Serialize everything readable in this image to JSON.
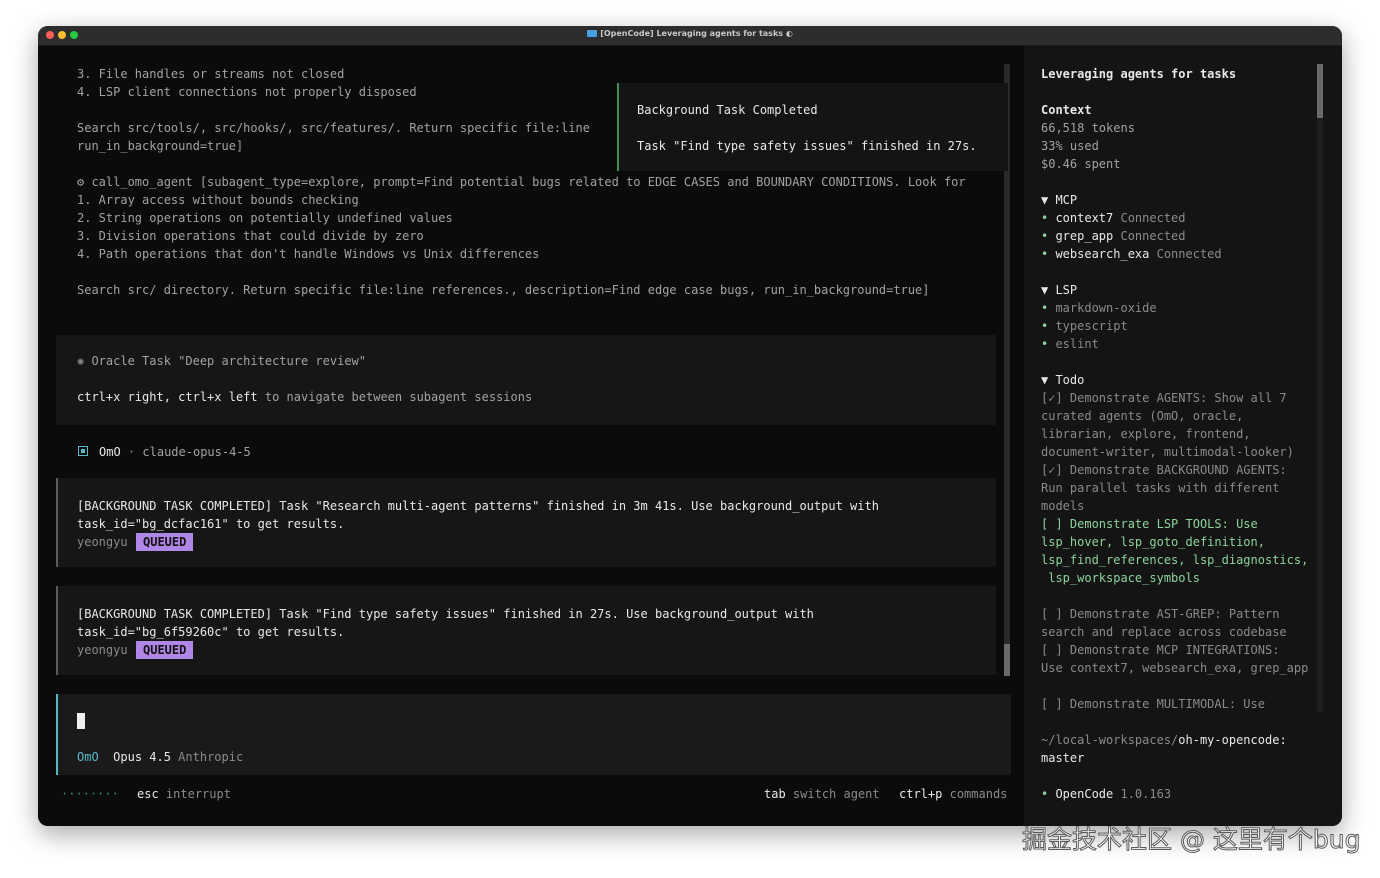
{
  "window": {
    "title": "[OpenCode] Leveraging agents for tasks ◐"
  },
  "main": {
    "top_lines": [
      "3. File handles or streams not closed",
      "4. LSP client connections not properly disposed"
    ],
    "search_lines": [
      "Search src/tools/, src/hooks/, src/features/. Return specific file:line",
      "run_in_background=true]"
    ],
    "call_line": "call_omo_agent [subagent_type=explore, prompt=Find potential bugs related to EDGE CASES and BOUNDARY CONDITIONS. Look for",
    "call_items": [
      "1. Array access without bounds checking",
      "2. String operations on potentially undefined values",
      "3. Division operations that could divide by zero",
      "4. Path operations that don't handle Windows vs Unix differences"
    ],
    "call_tail": "Search src/ directory. Return specific file:line references., description=Find edge case bugs, run_in_background=true]",
    "oracle": {
      "line": "Oracle Task \"Deep architecture review\"",
      "nav_keys1": "ctrl+x right",
      "nav_sep": ", ",
      "nav_keys2": "ctrl+x left",
      "nav_text": " to navigate between subagent sessions"
    },
    "agent": {
      "name": "OmO",
      "sep": "·",
      "model": "claude-opus-4-5"
    },
    "messages": [
      {
        "line1": "[BACKGROUND TASK COMPLETED] Task \"Research multi-agent patterns\" finished in 3m 41s. Use background_output with",
        "line2": "task_id=\"bg_dcfac161\" to get results.",
        "user": "yeongyu",
        "badge": "QUEUED"
      },
      {
        "line1": "[BACKGROUND TASK COMPLETED] Task \"Find type safety issues\" finished in 27s. Use background_output with",
        "line2": "task_id=\"bg_6f59260c\" to get results.",
        "user": "yeongyu",
        "badge": "QUEUED"
      }
    ],
    "input": {
      "agent": "OmO",
      "model": "Opus 4.5",
      "provider": "Anthropic"
    },
    "footer": {
      "dots": "········",
      "esc_key": "esc",
      "esc_label": "interrupt",
      "tab_key": "tab",
      "tab_label": "switch agent",
      "cmd_key": "ctrl+p",
      "cmd_label": "commands"
    }
  },
  "toast": {
    "title": "Background Task Completed",
    "body": "Task \"Find type safety issues\" finished in 27s."
  },
  "sidebar": {
    "title": "Leveraging agents for tasks",
    "context": {
      "heading": "Context",
      "tokens": "66,518 tokens",
      "used": "33% used",
      "spent": "$0.46 spent"
    },
    "mcp": {
      "heading": "MCP",
      "items": [
        {
          "name": "context7",
          "status": "Connected"
        },
        {
          "name": "grep_app",
          "status": "Connected"
        },
        {
          "name": "websearch_exa",
          "status": "Connected"
        }
      ]
    },
    "lsp": {
      "heading": "LSP",
      "items": [
        "markdown-oxide",
        "typescript",
        "eslint"
      ]
    },
    "todo": {
      "heading": "Todo",
      "lines": [
        "[✓] Demonstrate AGENTS: Show all 7",
        "curated agents (OmO, oracle,",
        "librarian, explore, frontend,",
        "document-writer, multimodal-looker)",
        "[✓] Demonstrate BACKGROUND AGENTS:",
        "Run parallel tasks with different",
        "models",
        "[ ] Demonstrate LSP TOOLS: Use",
        "lsp_hover, lsp_goto_definition,",
        "lsp_find_references, lsp_diagnostics,",
        " lsp_workspace_symbols",
        "",
        "[ ] Demonstrate AST-GREP: Pattern",
        "search and replace across codebase",
        "[ ] Demonstrate MCP INTEGRATIONS:",
        "Use context7, websearch_exa, grep_app",
        "",
        "[ ] Demonstrate MULTIMODAL: Use"
      ]
    },
    "path_prefix": "~/local-workspaces/",
    "path_repo": "oh-my-opencode",
    "path_sep": ":",
    "branch": "master",
    "app": {
      "name": "OpenCode",
      "version": "1.0.163"
    }
  },
  "watermark": "掘金技术社区 @ 这里有个bug",
  "colors": {
    "accent_green": "#8bd49a",
    "badge_purple": "#b086e6",
    "agent_cyan": "#57b8c8"
  }
}
